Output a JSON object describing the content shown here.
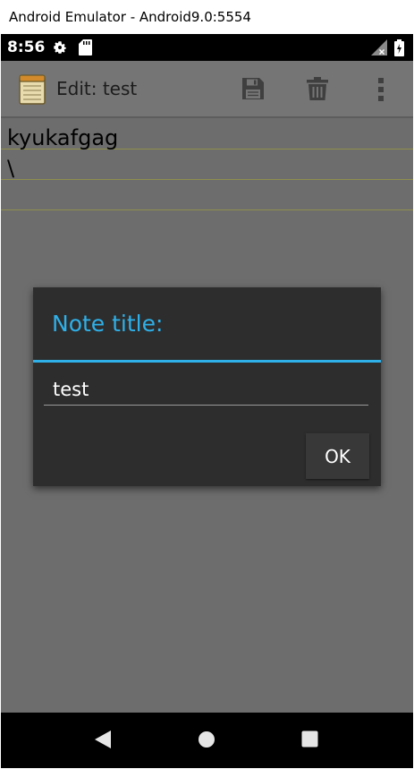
{
  "window": {
    "title": "Android Emulator - Android9.0:5554"
  },
  "status_bar": {
    "time": "8:56",
    "left_icons": [
      "gear-icon",
      "sd-card-icon"
    ],
    "right_icons": [
      "no-signal-icon",
      "battery-icon"
    ]
  },
  "action_bar": {
    "app_icon": "notepad-icon",
    "title": "Edit: test",
    "actions": [
      "save-icon",
      "delete-icon",
      "overflow-menu-icon"
    ]
  },
  "note": {
    "lines": [
      "kyukafgag",
      "\\"
    ]
  },
  "dialog": {
    "title": "Note title:",
    "input_value": "test",
    "ok_label": "OK"
  },
  "nav_bar": {
    "buttons": [
      "back-icon",
      "home-icon",
      "recents-icon"
    ]
  },
  "colors": {
    "accent": "#2fb0e8",
    "dialog_bg": "#2d2d2d",
    "action_bar_bg": "#757575",
    "dim_bg": "#6d6d6d"
  }
}
